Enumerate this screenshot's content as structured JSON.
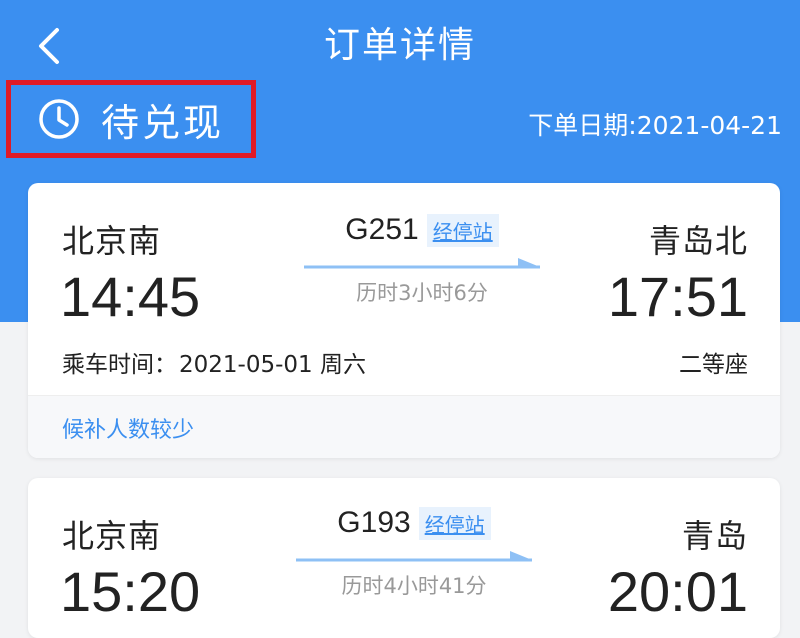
{
  "header": {
    "title": "订单详情",
    "back_icon": "chevron-left-icon",
    "status": "待兑现",
    "status_icon": "clock-icon",
    "order_date_label": "下单日期:",
    "order_date": "2021-04-21"
  },
  "colors": {
    "primary": "#3b8ff0",
    "highlight_border": "#e01a26",
    "text": "#222222",
    "muted": "#999999",
    "background": "#f2f3f5"
  },
  "tickets": [
    {
      "from_station": "北京南",
      "to_station": "青岛北",
      "departure": "14:45",
      "arrival": "17:51",
      "train_no": "G251",
      "stops_label": "经停站",
      "duration": "历时3小时6分",
      "ride_date_label": "乘车时间：",
      "ride_date": "2021-05-01 周六",
      "seat_class": "二等座",
      "note": "候补人数较少"
    },
    {
      "from_station": "北京南",
      "to_station": "青岛",
      "departure": "15:20",
      "arrival": "20:01",
      "train_no": "G193",
      "stops_label": "经停站",
      "duration": "历时4小时41分"
    }
  ]
}
